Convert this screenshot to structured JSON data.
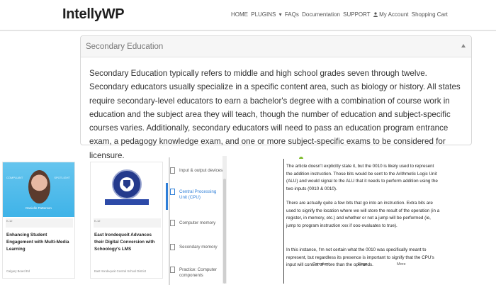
{
  "header": {
    "logo": "IntellyWP",
    "nav": {
      "home": "HOME",
      "plugins": "PLUGINS",
      "plugins_caret": "▾",
      "faqs": "FAQs",
      "documentation": "Documentation",
      "support": "SUPPORT",
      "account": "My Account",
      "cart": "Shopping Cart"
    }
  },
  "accordion": {
    "title": "Secondary Education",
    "body": "Secondary Education typically refers to middle and high school grades seven through twelve. Secondary educators usually specialize in a specific content area, such as biology or history. All states require secondary-level educators to earn a bachelor's degree with a combination of course work in education and the subject area they will teach, though the number of education and subject-specific courses varies. Additionally, secondary educators will need to pass an education program entrance exam, a pedagogy knowledge exam, and one or more subject-specific exams to be considered for licensure."
  },
  "cards": [
    {
      "img_left": "COMPLIANT",
      "img_right": "SPOTLIGHT",
      "img_name": "Danielle Patterson",
      "tag": "K-12",
      "title": "Enhancing Student Engagement with Multi-Media Learning",
      "footer": "Calgary Board Ed"
    },
    {
      "tag": "K-12",
      "title": "East Irondequoit Advances their Digital Conversion with Schoology's LMS",
      "footer": "East Irondequoit Central School District"
    }
  ],
  "outline": {
    "items": [
      {
        "label": "Input & output devices",
        "active": false
      },
      {
        "label": "Central Processing Unit (CPU)",
        "active": true
      },
      {
        "label": "Computer memory",
        "active": false
      },
      {
        "label": "Secondary memory",
        "active": false
      },
      {
        "label": "Practice: Computer components",
        "active": false
      }
    ]
  },
  "document": {
    "paragraphs": [
      "The article doesn't explicitly state it, but the 0010 is likely used to represent the addition instruction. Those bits would be sent to the Arithmetic Logic Unit (ALU) and would signal to the ALU that it needs to perform addition using the two inputs (0010 & 0010).",
      "There are actually quite a few bits that go into an instruction. Extra bits are used to signify the location where we will store the result of the operation (in a register, in memory, etc.) and whether or not a jump will be performed (ie, jump to program instruction xxx if ooo evaluates to true).",
      "In this instance, I'm not certain what the 0010 was specifically meant to represent, but regardless its presence is important to signify that the CPU's input will consist of more than the operands."
    ],
    "footer": {
      "comment": "Comment",
      "flags": "Flags",
      "actions": "More"
    }
  },
  "colors": {
    "accent": "#2f7fd8",
    "card_blue": "#45b5e9",
    "seal_blue": "#243a8c"
  }
}
